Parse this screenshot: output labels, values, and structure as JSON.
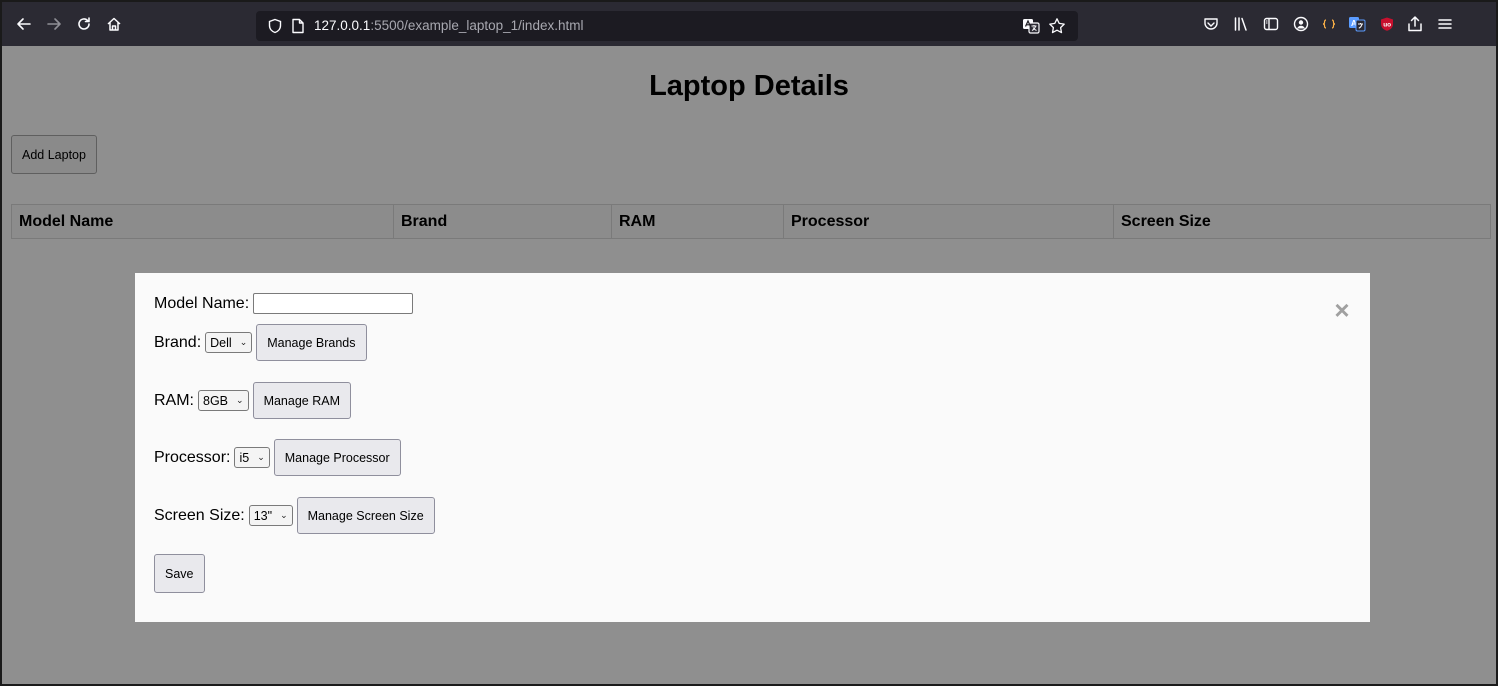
{
  "browser": {
    "url_host": "127.0.0.1",
    "url_rest": ":5500/example_laptop_1/index.html"
  },
  "page": {
    "title": "Laptop Details",
    "add_button_label": "Add Laptop",
    "table": {
      "columns": [
        "Model Name",
        "Brand",
        "RAM",
        "Processor",
        "Screen Size"
      ]
    }
  },
  "modal": {
    "close_symbol": "×",
    "model_name": {
      "label": "Model Name:",
      "value": ""
    },
    "brand": {
      "label": "Brand:",
      "selected": "Dell",
      "manage_label": "Manage Brands"
    },
    "ram": {
      "label": "RAM:",
      "selected": "8GB",
      "manage_label": "Manage RAM"
    },
    "processor": {
      "label": "Processor:",
      "selected": "i5",
      "manage_label": "Manage Processor"
    },
    "screen_size": {
      "label": "Screen Size:",
      "selected": "13\"",
      "manage_label": "Manage Screen Size"
    },
    "save_label": "Save"
  },
  "icons": {
    "toolbar": [
      "back-arrow-icon",
      "forward-arrow-icon",
      "reload-icon",
      "home-icon",
      "shield-icon",
      "page-icon",
      "translate-icon",
      "star-icon",
      "pocket-icon",
      "library-icon",
      "sidebar-icon",
      "account-icon",
      "extension-icon",
      "translate-extension-icon",
      "ublock-icon",
      "share-icon",
      "menu-icon"
    ]
  }
}
